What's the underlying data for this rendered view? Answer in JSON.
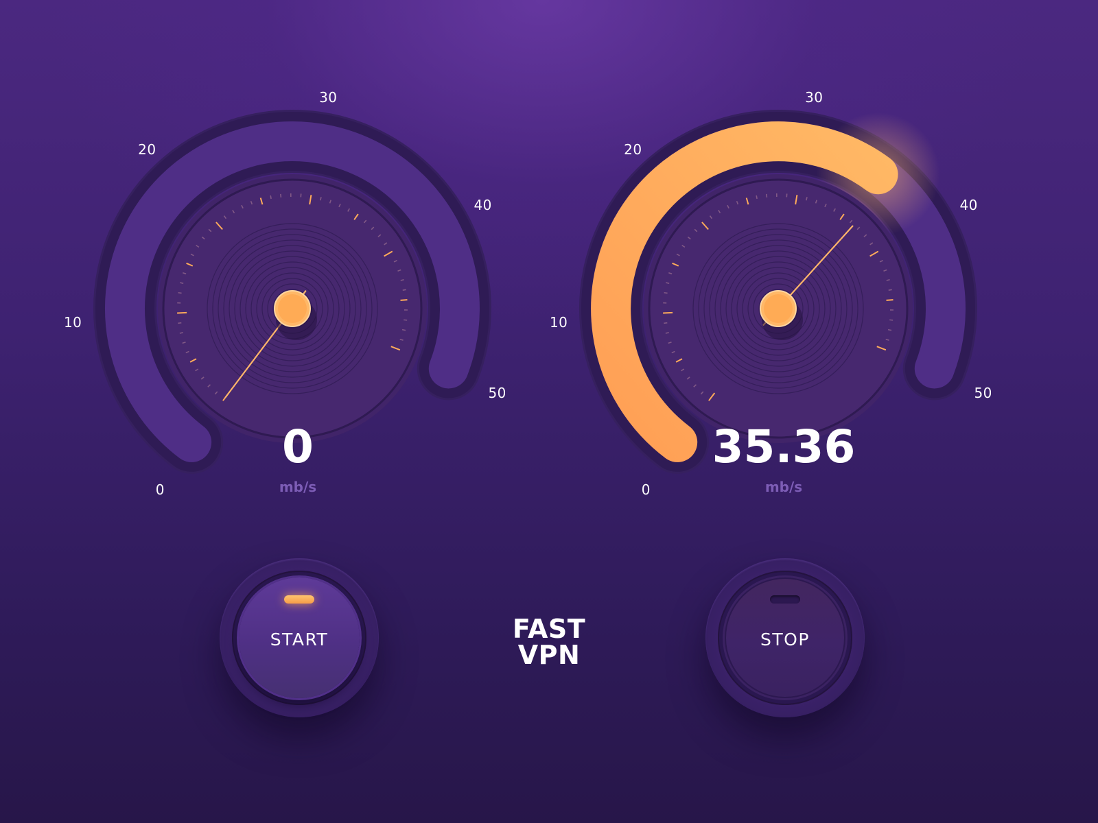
{
  "gauges": [
    {
      "id": "download",
      "value": "0",
      "unit": "mb/s",
      "reading": 0,
      "scale": {
        "min": 0,
        "max": 50,
        "labels": [
          "0",
          "10",
          "20",
          "30",
          "40",
          "50"
        ]
      },
      "arc_fill": 0,
      "needle_angle_deg": 217
    },
    {
      "id": "upload",
      "value": "35.36",
      "unit": "mb/s",
      "reading": 35.36,
      "scale": {
        "min": 0,
        "max": 50,
        "labels": [
          "0",
          "10",
          "20",
          "30",
          "40",
          "50"
        ]
      },
      "arc_fill": 35.36,
      "needle_angle_deg": 42
    }
  ],
  "buttons": {
    "start": {
      "label": "START",
      "active": true
    },
    "stop": {
      "label": "STOP",
      "active": false
    }
  },
  "brand": {
    "line1": "FAST",
    "line2": "VPN"
  },
  "colors": {
    "background": "#3e2271",
    "track": "#4f2e86",
    "accent": "#ffab5a",
    "unit_text": "#7d5db6"
  }
}
